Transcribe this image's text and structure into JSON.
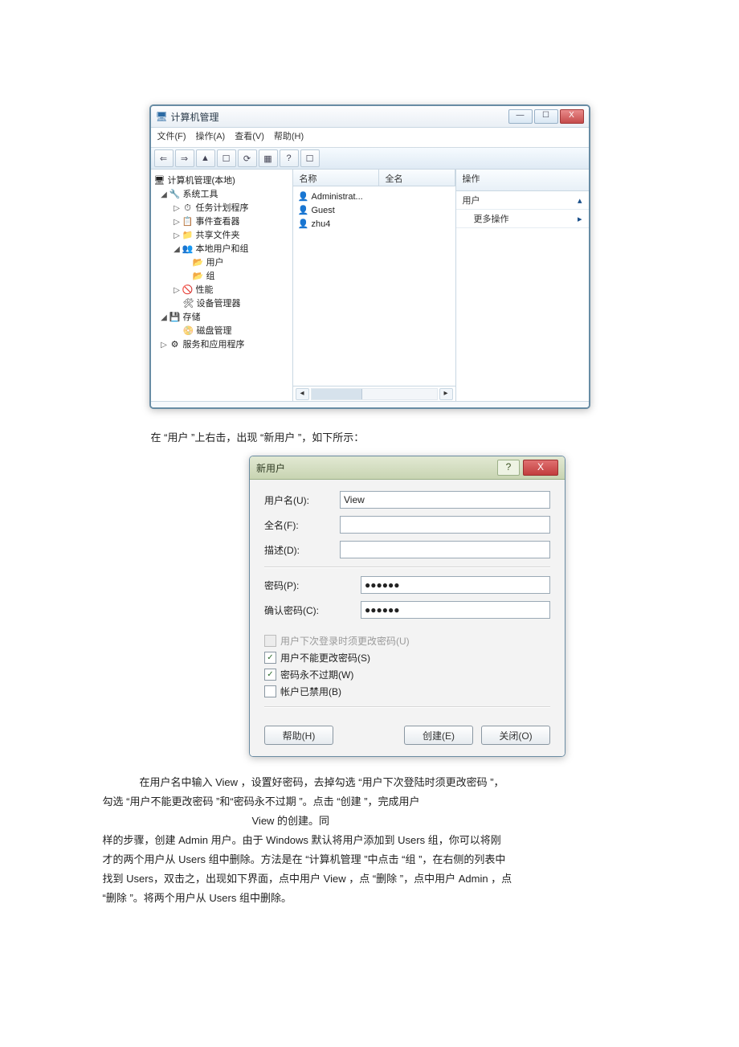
{
  "cm": {
    "title": "计算机管理",
    "menu": {
      "file": "文件(F)",
      "action": "操作(A)",
      "view": "查看(V)",
      "help": "帮助(H)"
    },
    "toolbar": [
      "⇐",
      "⇒",
      "▲",
      "☐",
      "⟳",
      "▦",
      "?",
      "☐"
    ],
    "tree": {
      "root": "计算机管理(本地)",
      "systools": "系统工具",
      "task": "任务计划程序",
      "event": "事件查看器",
      "share": "共享文件夹",
      "local": "本地用户和组",
      "users": "用户",
      "groups": "组",
      "perf": "性能",
      "devmgr": "设备管理器",
      "storage": "存储",
      "diskmgr": "磁盘管理",
      "services": "服务和应用程序"
    },
    "cols": {
      "name": "名称",
      "full": "全名"
    },
    "list": [
      "Administrat...",
      "Guest",
      "zhu4"
    ],
    "actions": {
      "hdr": "操作",
      "user": "用户",
      "more": "更多操作"
    }
  },
  "mid": "在 “用户 ”上右击，出现  “新用户 ”，如下所示：",
  "nu": {
    "title": "新用户",
    "lab": {
      "user": "用户名(U):",
      "full": "全名(F):",
      "desc": "描述(D):",
      "pw": "密码(P):",
      "cpw": "确认密码(C):"
    },
    "val": {
      "user": "View",
      "pw": "●●●●●●",
      "cpw": "●●●●●●"
    },
    "chk": {
      "must": "用户下次登录时须更改密码(U)",
      "cant": "用户不能更改密码(S)",
      "never": "密码永不过期(W)",
      "dis": "帐户已禁用(B)"
    },
    "btn": {
      "help": "帮助(H)",
      "create": "创建(E)",
      "close": "关闭(O)"
    }
  },
  "para": {
    "l1a": "在用户名中输入   View ，设置好密码，去掉勾选   “用户下次登陆时须更改密码   ”，",
    "l2": "勾选 “用户不能更改密码 ”和“密码永不过期                                  ”。点击 “创建 ”，完成用户",
    "l2b": "View 的创建。同",
    "l3": "样的步骤，创建   Admin 用户。由于   Windows 默认将用户添加到     Users 组，你可以将刚",
    "l4": "才的两个用户从   Users 组中删除。方法是在   “计算机管理 ”中点击 “组 ”，在右侧的列表中",
    "l5": "找到 Users，双击之，出现如下界面，点中用户       View ，点 “删除 ”，点中用户  Admin ，点",
    "l6": "“删除 ”。将两个用户从 Users 组中删除。"
  }
}
